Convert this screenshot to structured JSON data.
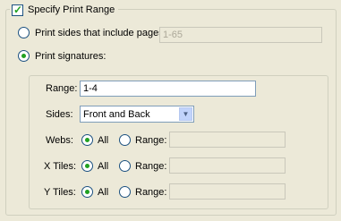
{
  "specify_print_range": {
    "label": "Specify Print Range",
    "checked": true
  },
  "print_sides": {
    "label": "Print sides that include pages:",
    "value": "1-65",
    "selected": false
  },
  "print_signatures": {
    "label": "Print signatures:",
    "selected": true
  },
  "range": {
    "label": "Range:",
    "value": "1-4"
  },
  "sides": {
    "label": "Sides:",
    "value": "Front and Back"
  },
  "webs": {
    "label": "Webs:",
    "all_label": "All",
    "range_label": "Range:",
    "selected": "All",
    "range_value": ""
  },
  "x_tiles": {
    "label": "X Tiles:",
    "all_label": "All",
    "range_label": "Range:",
    "selected": "All",
    "range_value": ""
  },
  "y_tiles": {
    "label": "Y Tiles:",
    "all_label": "All",
    "range_label": "Range:",
    "selected": "All",
    "range_value": ""
  }
}
